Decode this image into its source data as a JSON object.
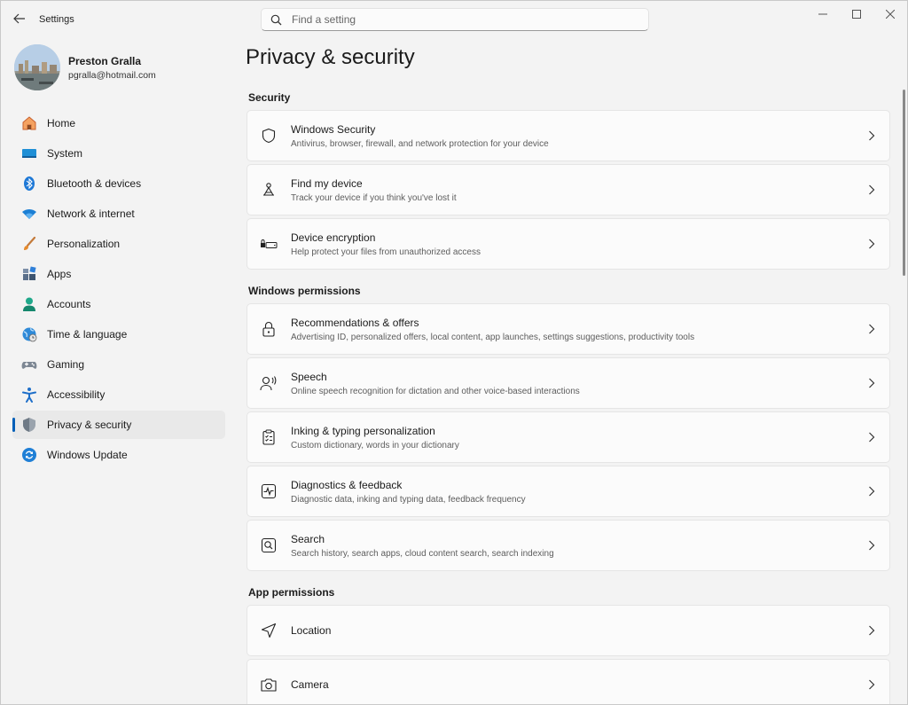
{
  "titlebar": {
    "app_title": "Settings",
    "search_placeholder": "Find a setting"
  },
  "profile": {
    "name": "Preston Gralla",
    "email": "pgralla@hotmail.com"
  },
  "sidebar": {
    "items": [
      {
        "label": "Home",
        "icon": "home-icon"
      },
      {
        "label": "System",
        "icon": "system-icon"
      },
      {
        "label": "Bluetooth & devices",
        "icon": "bluetooth-icon"
      },
      {
        "label": "Network & internet",
        "icon": "wifi-icon"
      },
      {
        "label": "Personalization",
        "icon": "brush-icon"
      },
      {
        "label": "Apps",
        "icon": "apps-icon"
      },
      {
        "label": "Accounts",
        "icon": "accounts-icon"
      },
      {
        "label": "Time & language",
        "icon": "globe-clock-icon"
      },
      {
        "label": "Gaming",
        "icon": "gamepad-icon"
      },
      {
        "label": "Accessibility",
        "icon": "accessibility-icon"
      },
      {
        "label": "Privacy & security",
        "icon": "shield-icon",
        "active": true
      },
      {
        "label": "Windows Update",
        "icon": "update-icon"
      }
    ]
  },
  "main": {
    "page_title": "Privacy & security",
    "sections": [
      {
        "title": "Security",
        "cards": [
          {
            "title": "Windows Security",
            "desc": "Antivirus, browser, firewall, and network protection for your device",
            "icon": "shield-outline-icon"
          },
          {
            "title": "Find my device",
            "desc": "Track your device if you think you've lost it",
            "icon": "find-device-icon"
          },
          {
            "title": "Device encryption",
            "desc": "Help protect your files from unauthorized access",
            "icon": "encryption-icon"
          }
        ]
      },
      {
        "title": "Windows permissions",
        "cards": [
          {
            "title": "Recommendations & offers",
            "desc": "Advertising ID, personalized offers, local content, app launches, settings suggestions, productivity tools",
            "icon": "lock-icon"
          },
          {
            "title": "Speech",
            "desc": "Online speech recognition for dictation and other voice-based interactions",
            "icon": "speech-icon"
          },
          {
            "title": "Inking & typing personalization",
            "desc": "Custom dictionary, words in your dictionary",
            "icon": "clipboard-icon"
          },
          {
            "title": "Diagnostics & feedback",
            "desc": "Diagnostic data, inking and typing data, feedback frequency",
            "icon": "diagnostics-icon"
          },
          {
            "title": "Search",
            "desc": "Search history, search apps, cloud content search, search indexing",
            "icon": "search-box-icon"
          }
        ]
      },
      {
        "title": "App permissions",
        "cards": [
          {
            "title": "Location",
            "desc": "",
            "icon": "location-icon"
          },
          {
            "title": "Camera",
            "desc": "",
            "icon": "camera-icon"
          }
        ]
      }
    ]
  },
  "colors": {
    "accent": "#005fb8",
    "background": "#f3f3f3",
    "card": "#fbfbfb"
  }
}
